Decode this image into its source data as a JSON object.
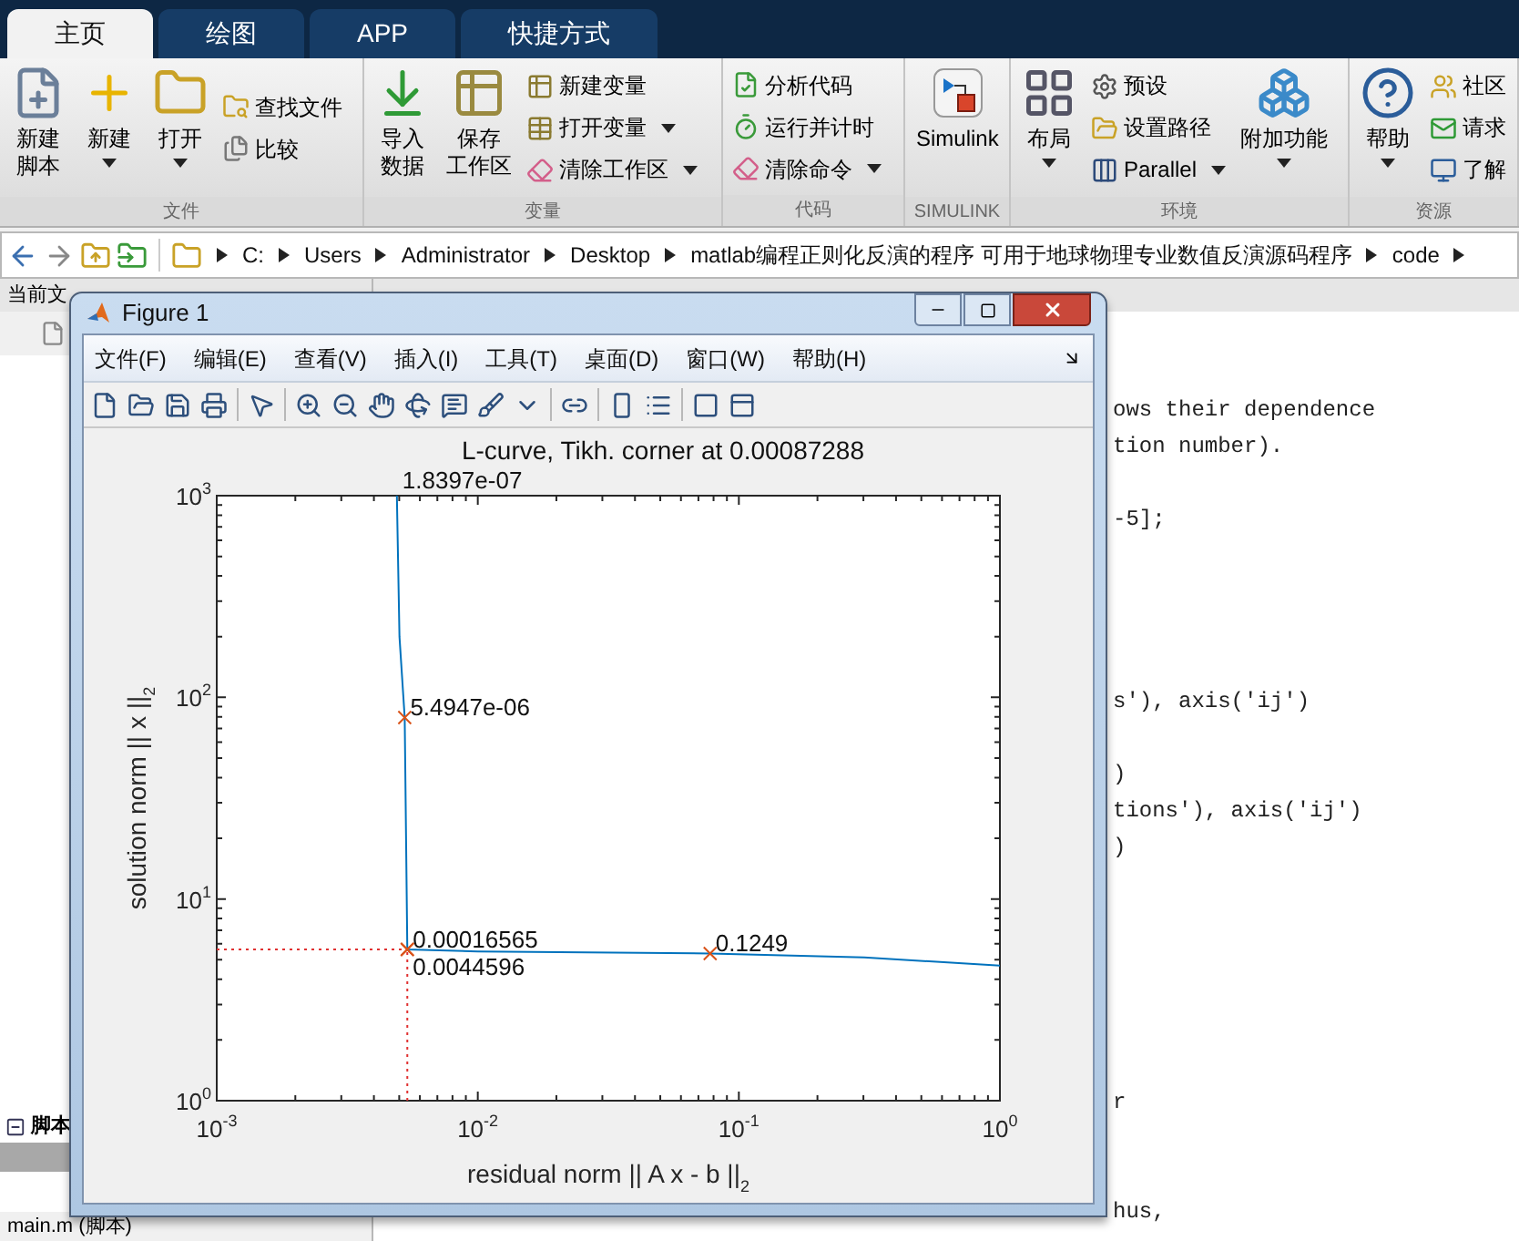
{
  "ribbon_tabs": [
    {
      "label": "主页",
      "selected": true
    },
    {
      "label": "绘图",
      "selected": false
    },
    {
      "label": "APP",
      "selected": false
    },
    {
      "label": "快捷方式",
      "selected": false
    }
  ],
  "toolstrip": [
    {
      "label": "文件",
      "items": [
        {
          "kind": "large",
          "lines": [
            "新建",
            "脚本"
          ],
          "dropdown": false
        },
        {
          "kind": "large",
          "lines": [
            "新建"
          ],
          "dropdown": true
        },
        {
          "kind": "large",
          "lines": [
            "打开"
          ],
          "dropdown": true
        },
        {
          "kind": "small",
          "label": "查找文件",
          "dropdown": false
        },
        {
          "kind": "small",
          "label": "比较",
          "dropdown": false
        }
      ]
    },
    {
      "label": "变量",
      "items": [
        {
          "kind": "large",
          "lines": [
            "导入",
            "数据"
          ],
          "dropdown": false
        },
        {
          "kind": "large",
          "lines": [
            "保存",
            "工作区"
          ],
          "dropdown": false
        },
        {
          "kind": "small",
          "label": "新建变量",
          "dropdown": false
        },
        {
          "kind": "small",
          "label": "打开变量",
          "dropdown": true
        },
        {
          "kind": "small",
          "label": "清除工作区",
          "dropdown": true
        }
      ]
    },
    {
      "label": "代码",
      "items": [
        {
          "kind": "small",
          "label": "分析代码",
          "dropdown": false
        },
        {
          "kind": "small",
          "label": "运行并计时",
          "dropdown": false
        },
        {
          "kind": "small",
          "label": "清除命令",
          "dropdown": true
        }
      ]
    },
    {
      "label": "SIMULINK",
      "items": [
        {
          "kind": "large",
          "lines": [
            "Simulink"
          ],
          "dropdown": false
        }
      ]
    },
    {
      "label": "环境",
      "items": [
        {
          "kind": "large",
          "lines": [
            "布局"
          ],
          "dropdown": true
        },
        {
          "kind": "small",
          "label": "预设",
          "dropdown": false
        },
        {
          "kind": "small",
          "label": "设置路径",
          "dropdown": false
        },
        {
          "kind": "small",
          "label": "Parallel",
          "dropdown": true
        },
        {
          "kind": "large",
          "lines": [
            "附加功能"
          ],
          "dropdown": true
        }
      ]
    },
    {
      "label": "资源",
      "items": [
        {
          "kind": "large",
          "lines": [
            "帮助"
          ],
          "dropdown": true
        },
        {
          "kind": "small",
          "label": "社区",
          "dropdown": false
        },
        {
          "kind": "small",
          "label": "请求",
          "dropdown": false
        },
        {
          "kind": "small",
          "label": "了解",
          "dropdown": false
        }
      ]
    }
  ],
  "address_bar": {
    "segments": [
      "C:",
      "Users",
      "Administrator",
      "Desktop",
      "matlab编程正则化反演的程序 可用于地球物理专业数值反演源码程序",
      "code"
    ]
  },
  "current_folder": {
    "title": "当前文",
    "section": "脚本",
    "file": "main.m  (脚本)"
  },
  "command_window": {
    "lines": [
      "ows their dependence",
      "tion number).",
      "-5];",
      "s'), axis('ij')",
      ")",
      "tions'), axis('ij')",
      ")",
      "r",
      "hus,"
    ]
  },
  "figure": {
    "title": "Figure 1",
    "menu": [
      "文件(F)",
      "编辑(E)",
      "查看(V)",
      "插入(I)",
      "工具(T)",
      "桌面(D)",
      "窗口(W)",
      "帮助(H)"
    ],
    "plot": {
      "title": "L-curve, Tikh. corner at 0.00087288",
      "xlabel": "residual norm || A x - b ||$_{2}$",
      "ylabel": "solution norm || x ||$_{2}$",
      "xtick_labels": [
        "10$^{-3}$",
        "10$^{-2}$",
        "10$^{-1}$",
        "10$^{0}$"
      ],
      "ytick_labels": [
        "10$^{3}$",
        "10$^{2}$",
        "10$^{1}$",
        "10$^{0}$"
      ],
      "point_labels": [
        "1.8397e-07",
        "5.4947e-06",
        "0.00016565",
        "0.0044596",
        "0.1249"
      ]
    }
  }
}
